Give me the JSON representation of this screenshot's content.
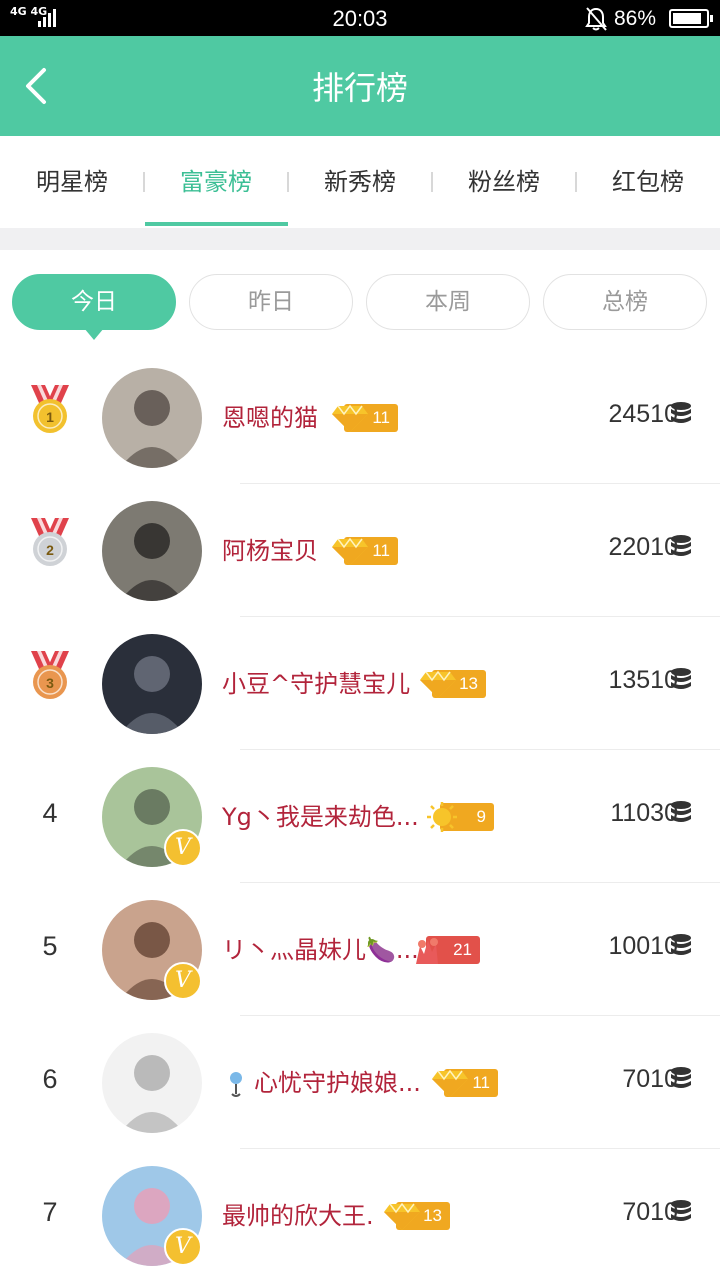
{
  "status_bar": {
    "network": "4G 4G",
    "time": "20:03",
    "battery_level": "86%",
    "battery_fraction": 0.86
  },
  "header": {
    "title": "排行榜",
    "back_icon": "chevron-left-icon"
  },
  "tabs": [
    {
      "label": "明星榜",
      "active": false
    },
    {
      "label": "富豪榜",
      "active": true
    },
    {
      "label": "新秀榜",
      "active": false
    },
    {
      "label": "粉丝榜",
      "active": false
    },
    {
      "label": "红包榜",
      "active": false
    }
  ],
  "periods": [
    {
      "label": "今日",
      "active": true
    },
    {
      "label": "昨日",
      "active": false
    },
    {
      "label": "本周",
      "active": false
    },
    {
      "label": "总榜",
      "active": false
    }
  ],
  "colors": {
    "accent": "#4fc9a2",
    "name": "#b2243b",
    "level_badge": "#f0a820",
    "level_badge_alt": "#e2514a",
    "medal_gold": "#f2c12e",
    "medal_silver": "#cfd2d6",
    "medal_bronze": "#e9964f"
  },
  "ranking": [
    {
      "rank": "1",
      "medal": "gold",
      "name": "恩嗯的猫",
      "prefix_icon": "",
      "badge_icon": "diamond-icon",
      "level": "11",
      "coins": "24510",
      "vip": false
    },
    {
      "rank": "2",
      "medal": "silver",
      "name": "阿杨宝贝",
      "prefix_icon": "",
      "badge_icon": "diamond-icon",
      "level": "11",
      "coins": "22010",
      "vip": false
    },
    {
      "rank": "3",
      "medal": "bronze",
      "name": "小豆^守护慧宝儿",
      "prefix_icon": "",
      "badge_icon": "diamond-icon",
      "level": "13",
      "coins": "13510",
      "vip": false
    },
    {
      "rank": "4",
      "medal": "",
      "name": "Yg丶我是来劫色...",
      "prefix_icon": "",
      "badge_icon": "sun-icon",
      "level": "9",
      "coins": "11030",
      "vip": true
    },
    {
      "rank": "5",
      "medal": "",
      "name": "リ丶灬晶妹儿🍆...",
      "prefix_icon": "",
      "badge_icon": "flower-icon",
      "level": "21",
      "coins": "10010",
      "vip": true
    },
    {
      "rank": "6",
      "medal": "",
      "name": "心忧守护娘娘...",
      "prefix_icon": "pin-icon",
      "badge_icon": "diamond-icon",
      "level": "11",
      "coins": "7010",
      "vip": false
    },
    {
      "rank": "7",
      "medal": "",
      "name": "最帅的欣大王.",
      "prefix_icon": "",
      "badge_icon": "diamond-icon",
      "level": "13",
      "coins": "7010",
      "vip": true
    }
  ]
}
